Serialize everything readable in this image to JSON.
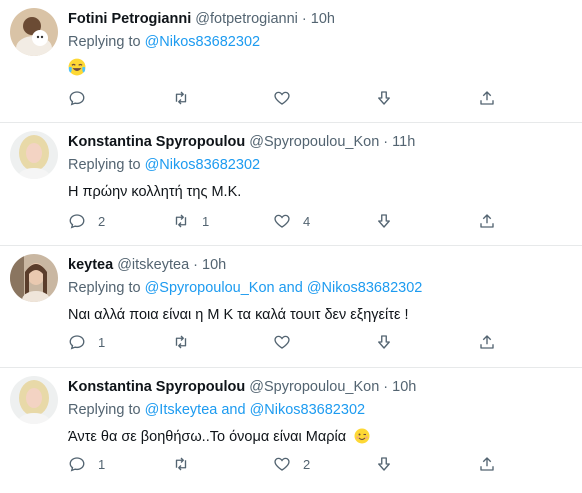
{
  "tweets": [
    {
      "name": "Fotini Petrogianni",
      "handle": "@fotpetrogianni",
      "time": "10h",
      "replying_prefix": "Replying to",
      "replying_to": "@Nikos83682302",
      "text": "",
      "emoji": "face-with-tears-of-joy",
      "counts": {
        "reply": "",
        "retweet": "",
        "like": ""
      }
    },
    {
      "name": "Konstantina Spyropoulou",
      "handle": "@Spyropoulou_Kon",
      "time": "11h",
      "replying_prefix": "Replying to",
      "replying_to": "@Nikos83682302",
      "text": "Η πρώην κολλητή της Μ.Κ.",
      "counts": {
        "reply": "2",
        "retweet": "1",
        "like": "4"
      }
    },
    {
      "name": "keytea",
      "handle": "@itskeytea",
      "time": "10h",
      "replying_prefix": "Replying to",
      "replying_to": "@Spyropoulou_Kon and @Nikos83682302",
      "text": "Ναι αλλά ποια είναι η Μ Κ τα καλά τουιτ δεν εξηγείτε !",
      "counts": {
        "reply": "1",
        "retweet": "",
        "like": ""
      }
    },
    {
      "name": "Konstantina Spyropoulou",
      "handle": "@Spyropoulou_Kon",
      "time": "10h",
      "replying_prefix": "Replying to",
      "replying_to": "@Itskeytea and @Nikos83682302",
      "text": "Άντε θα σε βοηθήσω..Το όνομα είναι Μαρία",
      "emoji": "winking-face",
      "counts": {
        "reply": "1",
        "retweet": "",
        "like": "2"
      }
    }
  ],
  "dot": "·"
}
